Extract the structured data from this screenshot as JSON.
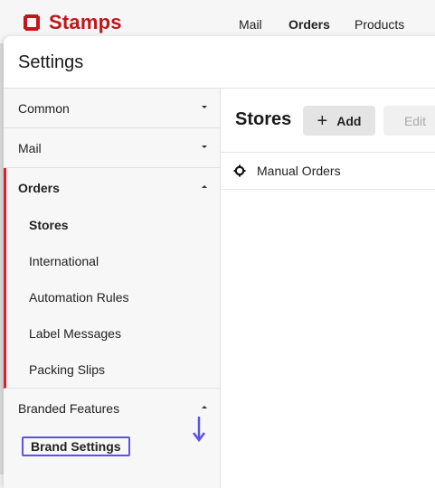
{
  "app": {
    "brand_name": "Stamps",
    "brand_color": "#c0151b",
    "nav": [
      "Mail",
      "Orders",
      "Products"
    ]
  },
  "modal": {
    "title": "Settings"
  },
  "sidebar": {
    "sections": [
      {
        "label": "Common",
        "expanded": false
      },
      {
        "label": "Mail",
        "expanded": false
      },
      {
        "label": "Orders",
        "expanded": true,
        "items": [
          "Stores",
          "International",
          "Automation Rules",
          "Label Messages",
          "Packing Slips"
        ],
        "active_item": "Stores"
      },
      {
        "label": "Branded Features",
        "expanded": true,
        "items": [
          "Brand Settings"
        ]
      }
    ]
  },
  "content": {
    "title": "Stores",
    "add_label": "Add",
    "edit_label": "Edit",
    "stores": [
      {
        "name": "Manual Orders",
        "icon": "gear-icon"
      }
    ]
  },
  "colors": {
    "accent_red": "#e21f26",
    "annotation_purple": "#5b52e8"
  }
}
